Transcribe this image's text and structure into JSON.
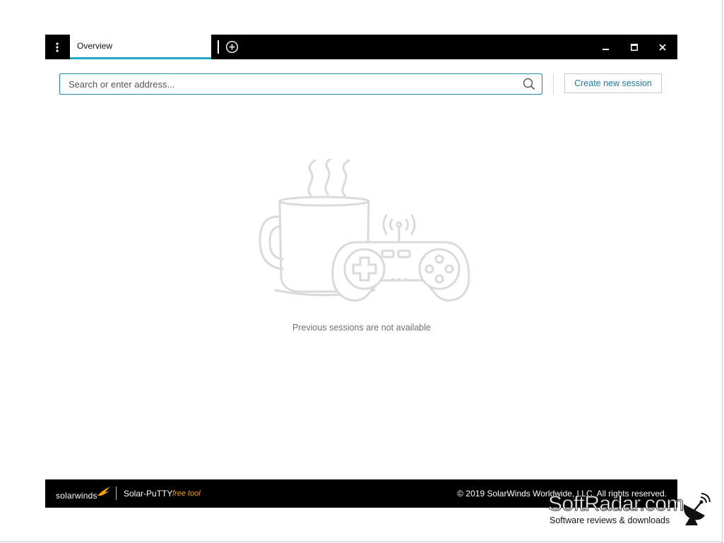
{
  "tabs": [
    {
      "label": "Overview",
      "active": true
    }
  ],
  "search": {
    "placeholder": "Search or enter address...",
    "value": ""
  },
  "toolbar": {
    "create_session_label": "Create new session"
  },
  "empty_state": {
    "message": "Previous sessions are not available"
  },
  "footer": {
    "brand": "solarwinds",
    "product": "Solar-PuTTY",
    "free_label": "free tool",
    "copyright": "© 2019 SolarWinds Worldwide, LLC. All rights reserved."
  },
  "watermark": {
    "title": "SoftRadar.com",
    "subtitle": "Software reviews & downloads"
  },
  "icons": {
    "menu": "vertical-dots-icon",
    "add_tab": "plus-circle-icon",
    "minimize": "minimize-icon",
    "maximize": "maximize-icon",
    "close": "close-icon",
    "search": "search-icon"
  },
  "colors": {
    "accent": "#1fa7c5",
    "titlebar": "#000000",
    "link": "#1a7aa0",
    "free_tag": "#f39c12"
  }
}
